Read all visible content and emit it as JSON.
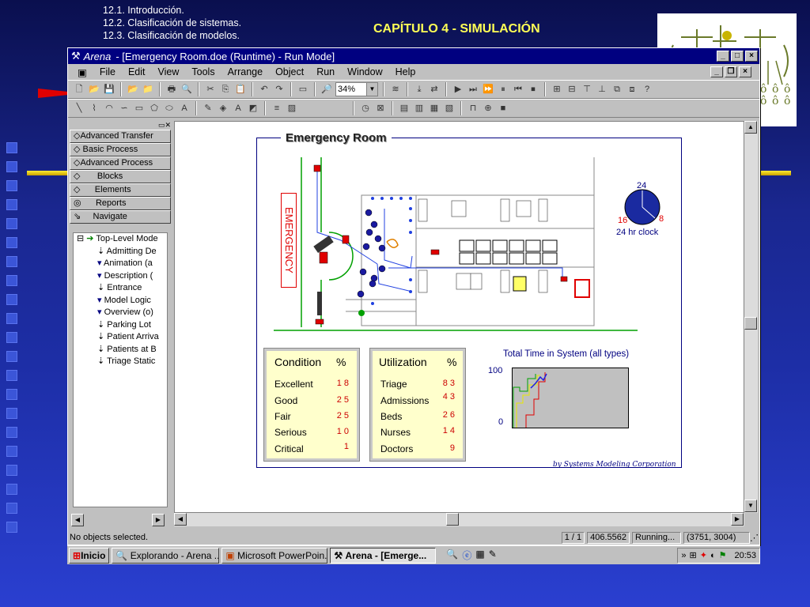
{
  "slide": {
    "topics": [
      "12.1. Introducción.",
      "12.2. Clasificación de sistemas.",
      "12.3. Clasificación de modelos."
    ],
    "title": "CAPÍTULO 4 - SIMULACIÓN"
  },
  "window": {
    "app_name": "Arena",
    "title": " - [Emergency Room.doe (Runtime) - Run Mode]",
    "menu": [
      "File",
      "Edit",
      "View",
      "Tools",
      "Arrange",
      "Object",
      "Run",
      "Window",
      "Help"
    ],
    "zoom": "34%"
  },
  "project_bar": {
    "panels": [
      "Advanced Transfer",
      "Basic Process",
      "Advanced Process",
      "Blocks",
      "Elements",
      "Reports",
      "Navigate"
    ],
    "tree_root": "Top-Level Mode",
    "tree_items": [
      "Admitting De",
      "Animation (a",
      "Description (",
      "Entrance",
      "Model Logic",
      "Overview (o)",
      "Parking Lot",
      "Patient Arriva",
      "Patients at B",
      "Triage Static"
    ]
  },
  "model": {
    "title": "Emergency Room",
    "emergency_sign": "EMERGENCY",
    "clock": {
      "top": "24",
      "left": "16",
      "right": "8",
      "label": "24 hr clock"
    },
    "condition": {
      "header": "Condition",
      "pct": "%",
      "rows": [
        {
          "label": "Excellent",
          "value": "1 8"
        },
        {
          "label": "Good",
          "value": "2 5"
        },
        {
          "label": "Fair",
          "value": "2 5"
        },
        {
          "label": "Serious",
          "value": "1 0"
        },
        {
          "label": "Critical",
          "value": "1"
        }
      ]
    },
    "utilization": {
      "header": "Utilization",
      "pct": "%",
      "rows": [
        {
          "label": "Triage",
          "value": "8 3"
        },
        {
          "label": "Admissions",
          "value": "4 3"
        },
        {
          "label": "Beds",
          "value": "2 6"
        },
        {
          "label": "Nurses",
          "value": "1 4"
        },
        {
          "label": "Doctors",
          "value": "9"
        }
      ]
    },
    "plot": {
      "title": "Total Time in System (all types)",
      "ymax": "100",
      "ymin": "0"
    },
    "credit": "by Systems Modeling Corporation"
  },
  "status": {
    "message": "No objects selected.",
    "page": "1 / 1",
    "time": "406.5562",
    "state": "Running...",
    "coords": "(3751, 3004)"
  },
  "taskbar": {
    "start": "Inicio",
    "tasks": [
      "Explorando - Arena ...",
      "Microsoft PowerPoin...",
      "Arena - [Emerge..."
    ],
    "clock": "20:53"
  }
}
